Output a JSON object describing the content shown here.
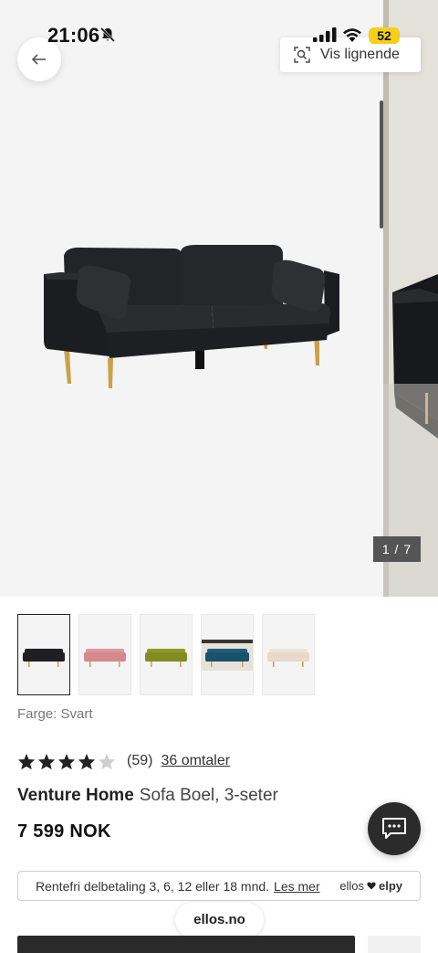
{
  "status_bar": {
    "time": "21:06",
    "battery": "52",
    "icons": [
      "bell-off-icon",
      "signal-icon",
      "wifi-icon",
      "battery-icon"
    ]
  },
  "header": {
    "back_icon": "arrow-left-icon",
    "similar_button": "Vis lignende",
    "similar_icon": "visual-search-icon"
  },
  "gallery": {
    "counter": "1 / 7",
    "thumbnails": [
      {
        "color": "#1f1f22",
        "name": "Svart"
      },
      {
        "color": "#d99a9c",
        "name": "Rosa"
      },
      {
        "color": "#8c9a2a",
        "name": "Grønn"
      },
      {
        "color": "#1f5d7a",
        "name": "Blå"
      },
      {
        "color": "#efe3d7",
        "name": "Beige"
      }
    ]
  },
  "product": {
    "color_label": "Farge: Svart",
    "rating": 4,
    "rating_max": 5,
    "rating_count": "(59)",
    "reviews_link": "36 omtaler",
    "brand": "Venture Home",
    "name": "Sofa Boel, 3-seter",
    "price": "7 599 NOK"
  },
  "installment": {
    "text": "Rentefri delbetaling 3, 6, 12 eller 18 mnd.",
    "link": "Les mer",
    "logo_a": "ellos",
    "logo_b": "elpy"
  },
  "chat_icon": "chat-bubble-icon",
  "browser": {
    "url": "ellos.no"
  }
}
